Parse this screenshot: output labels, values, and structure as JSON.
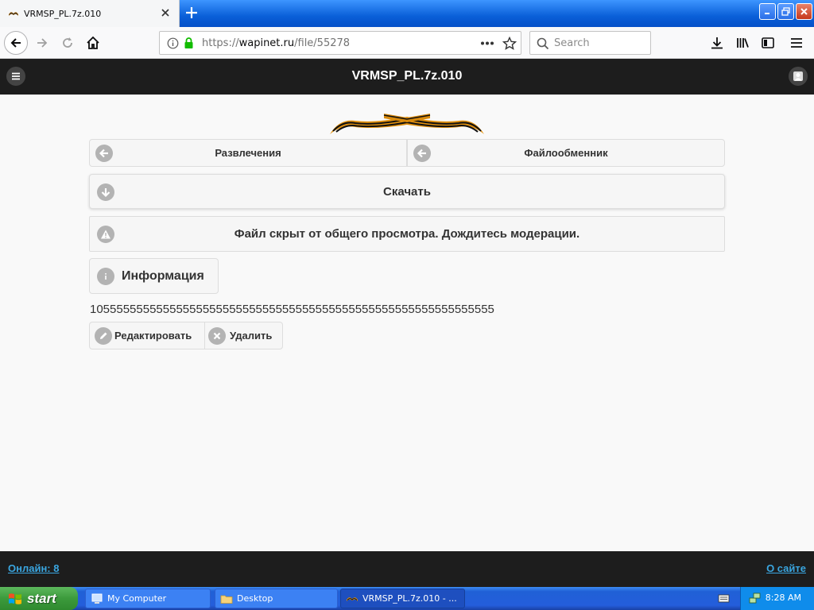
{
  "browser": {
    "tab_title": "VRMSP_PL.7z.010",
    "url_prefix": "https://",
    "url_host": "wapinet.ru",
    "url_path": "/file/55278",
    "search_placeholder": "Search"
  },
  "header": {
    "title": "VRMSP_PL.7z.010"
  },
  "nav": {
    "left_label": "Развлечения",
    "right_label": "Файлообменник"
  },
  "download_label": "Скачать",
  "notice_text": "Файл скрыт от общего просмотра. Дождитесь модерации.",
  "info_label": "Информация",
  "description": "1055555555555555555555555555555555555555555555555555555555555",
  "actions": {
    "edit_label": "Редактировать",
    "delete_label": "Удалить"
  },
  "footer": {
    "online_label": "Онлайн: 8",
    "about_label": "О сайте"
  },
  "taskbar": {
    "start_label": "start",
    "tasks": [
      "My Computer",
      "Desktop",
      "VRMSP_PL.7z.010 - ..."
    ],
    "clock": "8:28 AM"
  },
  "colors": {
    "header_bg": "#1d1d1d",
    "link": "#3aa6e0",
    "button_bg": "#f6f6f6",
    "icon_grey": "#b3b3b3"
  }
}
